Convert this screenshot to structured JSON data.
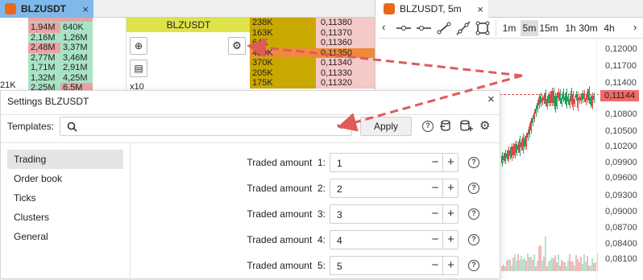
{
  "left_panel": {
    "tab_title": "BLZUSDT",
    "side_label": "21K",
    "volume_rows": [
      [
        "1,94M",
        "640K"
      ],
      [
        "2,16M",
        "1,26M"
      ],
      [
        "2,48M",
        "3,37M"
      ],
      [
        "2,77M",
        "3,46M"
      ],
      [
        "1,71M",
        "2,91M"
      ],
      [
        "1,32M",
        "4,25M"
      ],
      [
        "2,25M",
        "6,5M"
      ]
    ],
    "dom_title": "BLZUSDT",
    "dom_multiplier": "x10",
    "dom_rows": [
      [
        "238K",
        "0,11380"
      ],
      [
        "163K",
        "0,11370"
      ],
      [
        "64K",
        "0,11360"
      ],
      [
        "409K",
        "0,11350"
      ],
      [
        "370K",
        "0,11340"
      ],
      [
        "205K",
        "0,11330"
      ],
      [
        "175K",
        "0,11320"
      ]
    ]
  },
  "chart_panel": {
    "tab_title": "BLZUSDT, 5m",
    "timeframes": [
      "1m",
      "5m",
      "15m",
      "1h",
      "30m",
      "4h"
    ],
    "active_timeframe": "5m",
    "price_labels": [
      "0,12000",
      "0,11700",
      "0,11400",
      "0,11144",
      "0,10800",
      "0,10500",
      "0,10200",
      "0,09900",
      "0,09600",
      "0,09300",
      "0,09000",
      "0,08700",
      "0,08400",
      "0,08100"
    ],
    "current_price": "0,11144",
    "colors": {
      "up": "#20a060",
      "down": "#e04848",
      "price_tag": "#f26b6b"
    }
  },
  "settings_dialog": {
    "title": "Settings BLZUSDT",
    "close_glyph": "×",
    "templates_label": "Templates:",
    "templates_value": "",
    "apply_label": "Apply",
    "nav_items": [
      "Trading",
      "Order book",
      "Ticks",
      "Clusters",
      "General"
    ],
    "selected_nav": "Trading",
    "traded_amounts": [
      {
        "label": "Traded amount  1:",
        "value": "1"
      },
      {
        "label": "Traded amount  2:",
        "value": "2"
      },
      {
        "label": "Traded amount  3:",
        "value": "3"
      },
      {
        "label": "Traded amount  4:",
        "value": "4"
      },
      {
        "label": "Traded amount  5:",
        "value": "5"
      }
    ]
  }
}
